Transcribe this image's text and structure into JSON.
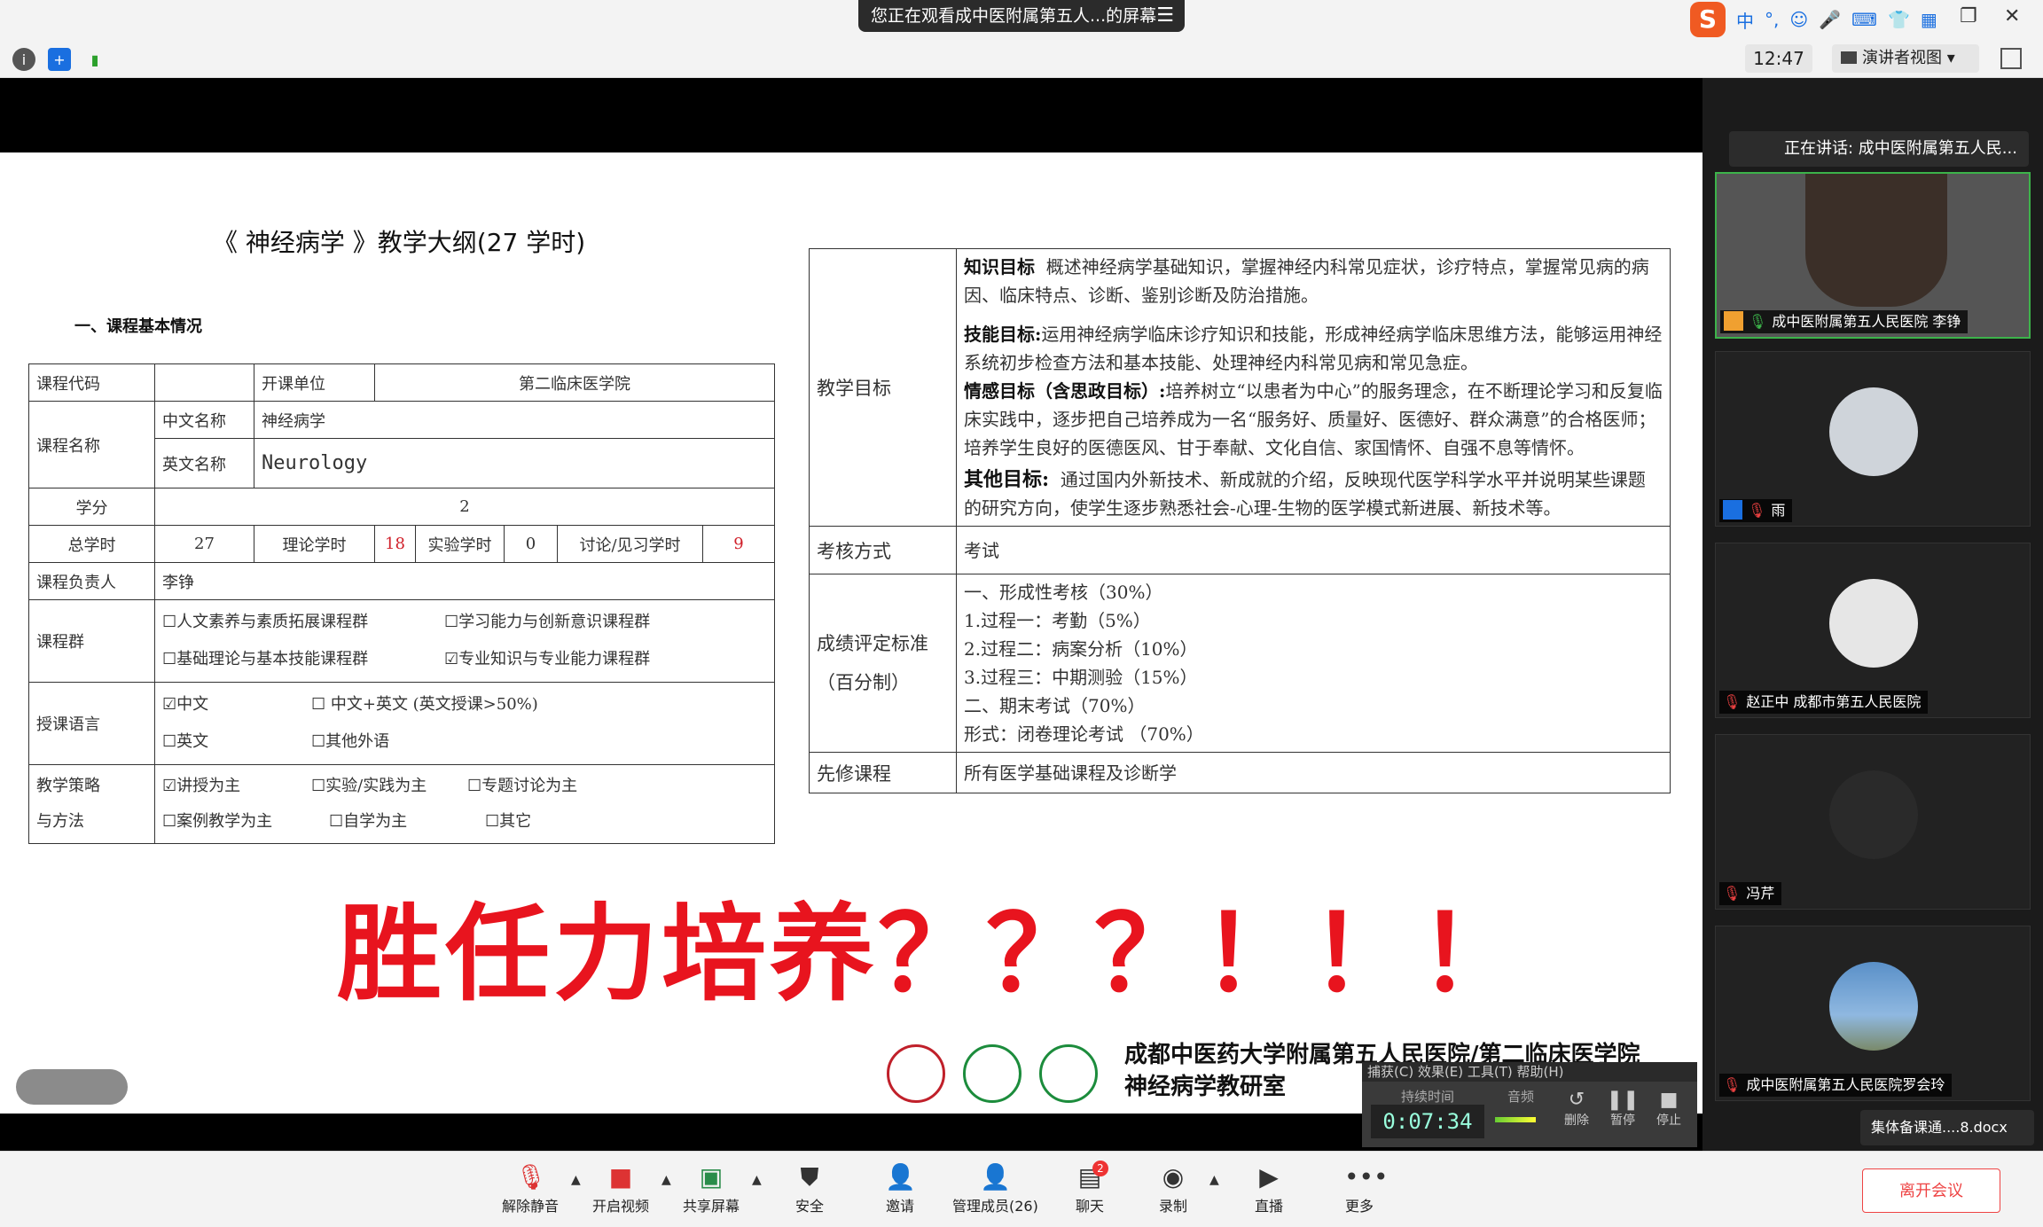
{
  "topbar": {
    "viewing_text": "您正在观看成中医附属第五人...的屏幕",
    "clock": "12:47",
    "speaker_view_label": "演讲者视图",
    "tray_ime": "中"
  },
  "slide": {
    "doc_title": "《 神经病学 》教学大纲(27 学时)",
    "section_title": "一、课程基本情况",
    "left_table": {
      "course_code_label": "课程代码",
      "unit_label": "开课单位",
      "unit_value": "第二临床医学院",
      "course_name_label": "课程名称",
      "cn_name_label": "中文名称",
      "cn_name_value": "神经病学",
      "en_name_label": "英文名称",
      "en_name_value": "Neurology",
      "credit_label": "学分",
      "credit_value": "2",
      "total_hours_label": "总学时",
      "total_hours_value": "27",
      "theory_hours_label": "理论学时",
      "theory_hours_value": "18",
      "lab_hours_label": "实验学时",
      "lab_hours_value": "0",
      "discuss_hours_label": "讨论/见习学时",
      "discuss_hours_value": "9",
      "lead_label": "课程负责人",
      "lead_value": "李铮",
      "group_label": "课程群",
      "group_opt1": "☐人文素养与素质拓展课程群",
      "group_opt2": "☐学习能力与创新意识课程群",
      "group_opt3": "☐基础理论与基本技能课程群",
      "group_opt4": "☑专业知识与专业能力课程群",
      "lang_label": "授课语言",
      "lang_opt1": "☑中文",
      "lang_opt2": "☐ 中文+英文 (英文授课>50%)",
      "lang_opt3": "☐英文",
      "lang_opt4": "☐其他外语",
      "strategy_label_1": "教学策略",
      "strategy_label_2": "与方法",
      "strategy_opt1": "☑讲授为主",
      "strategy_opt2": "☐实验/实践为主",
      "strategy_opt3": "☐专题讨论为主",
      "strategy_opt4": "☐案例教学为主",
      "strategy_opt5": "☐自学为主",
      "strategy_opt6": "☐其它"
    },
    "right_table": {
      "goal_label": "教学目标",
      "knowledge_head": "知识目标",
      "knowledge_text": "概述神经病学基础知识，掌握神经内科常见症状，诊疗特点，掌握常见病的病因、临床特点、诊断、鉴别诊断及防治措施。",
      "skill_head": "技能目标:",
      "skill_text": "运用神经病学临床诊疗知识和技能，形成神经病学临床思维方法，能够运用神经系统初步检查方法和基本技能、处理神经内科常见病和常见急症。",
      "emotion_head": "情感目标（含思政目标）:",
      "emotion_text": "培养树立“以患者为中心”的服务理念，在不断理论学习和反复临床实践中，逐步把自己培养成为一名“服务好、质量好、医德好、群众满意”的合格医师；培养学生良好的医德医风、甘于奉献、文化自信、家国情怀、自强不息等情怀。",
      "other_head": "其他目标:",
      "other_text": "通过国内外新技术、新成就的介绍，反映现代医学科学水平并说明某些课题的研究方向，使学生逐步熟悉社会-心理-生物的医学模式新进展、新技术等。",
      "exam_label": "考核方式",
      "exam_value": "考试",
      "grade_label_1": "成绩评定标准",
      "grade_label_2": "（百分制）",
      "grade_lines": [
        "一、形成性考核（30%）",
        "1.过程一：考勤（5%）",
        "2.过程二：病案分析（10%）",
        "3.过程三：中期测验（15%）",
        "二、期末考试（70%）",
        "形式：闭卷理论考试 （70%）"
      ],
      "prereq_label": "先修课程",
      "prereq_value": "所有医学基础课程及诊断学"
    },
    "big_text": "胜任力培养？？？！！！",
    "hospital_line1": "成都中医药大学附属第五人民医院/第二临床医学院",
    "hospital_line2": "神经病学教研室"
  },
  "recorder": {
    "menu": "捕获(C) 效果(E) 工具(T) 帮助(H)",
    "duration_label": "持续时间",
    "duration_value": "0:07:34",
    "audio_label": "音频",
    "delete_label": "删除",
    "pause_label": "暂停",
    "stop_label": "停止"
  },
  "gallery": {
    "speaking_text": "正在讲话: 成中医附属第五人民...",
    "tiles": [
      {
        "name": "成中医附属第五人民医院 李铮"
      },
      {
        "name": "雨"
      },
      {
        "name": "赵正中 成都市第五人民医院"
      },
      {
        "name": "冯芹"
      },
      {
        "name": "成中医附属第五人民医院罗会玲"
      }
    ],
    "file_name": "集体备课通....8.docx",
    "leave_label": "离开会议"
  },
  "toolbar": {
    "unmute": "解除静音",
    "video": "开启视频",
    "share": "共享屏幕",
    "security": "安全",
    "invite": "邀请",
    "members": "管理成员(26)",
    "chat": "聊天",
    "chat_badge": "2",
    "record": "录制",
    "live": "直播",
    "more": "更多"
  },
  "colors": {
    "accent_red": "#e8141e",
    "active_green": "#3cb34a",
    "toolbar_bg": "#f3f3f3"
  }
}
